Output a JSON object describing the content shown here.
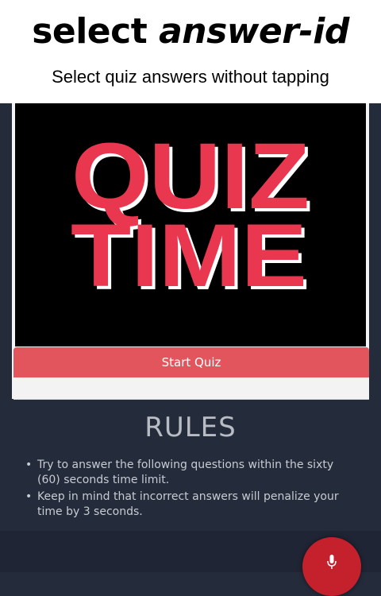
{
  "caption": {
    "title_regular": "select ",
    "title_italic": "answer-id",
    "subtitle": "Select quiz answers without tapping"
  },
  "quiz_card": {
    "image_line1": "QUIZ",
    "image_line2": "TIME",
    "start_button_label": "Start Quiz"
  },
  "rules": {
    "heading": "RULES",
    "items": [
      {
        "bullet": "•",
        "line1": "Try to answer the following questions within the sixty",
        "line2": "(60) seconds time limit."
      },
      {
        "bullet": "•",
        "line1": "Keep in mind that incorrect answers will penalize your",
        "line2": "time by 3 seconds."
      }
    ]
  },
  "voice": {
    "icon": "microphone-icon"
  },
  "colors": {
    "page_background": "#242b3a",
    "accent_red": "#e2555d",
    "quiz_text_red": "#e8374f",
    "mic_red": "#c4212d"
  }
}
